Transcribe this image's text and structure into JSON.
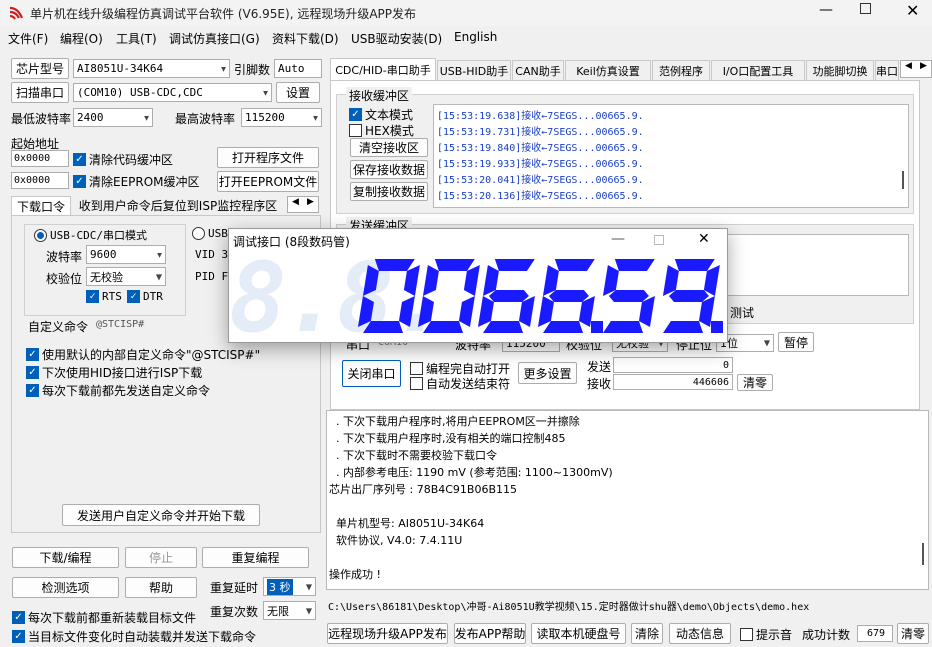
{
  "window": {
    "title": "单片机在线升级编程仿真调试平台软件 (V6.95E), 远程现场升级APP发布"
  },
  "menu": [
    "文件(F)",
    "编程(O)",
    "工具(T)",
    "调试仿真接口(G)",
    "资料下载(D)",
    "USB驱动安装(D)",
    "English"
  ],
  "left": {
    "chip_label": "芯片型号",
    "chip_value": "AI8051U-34K64",
    "rate_label": "引脚数",
    "rate_value": "Auto",
    "scan_label": "扫描串口",
    "port_value": "(COM10) USB-CDC,CDC",
    "settings_label": "设置",
    "min_baud_label": "最低波特率",
    "min_baud_value": "2400",
    "max_baud_label": "最高波特率",
    "max_baud_value": "115200",
    "start_addr_label": "起始地址",
    "addr1": "0x0000",
    "clear_code_label": "清除代码缓冲区",
    "open_prog_label": "打开程序文件",
    "addr2": "0x0000",
    "clear_eeprom_label": "清除EEPROM缓冲区",
    "open_eeprom_label": "打开EEPROM文件",
    "tab1": "下载口令",
    "tab2": "收到用户命令后复位到ISP监控程序区",
    "mode1": "USB-CDC/串口模式",
    "mode2": "USB",
    "baud_label": "波特率",
    "baud_value": "9600",
    "parity_label": "校验位",
    "parity_value": "无校验",
    "rts": "RTS",
    "dtr": "DTR",
    "vid": "VID  3",
    "pid": "PID  F",
    "custom_cmd_label": "自定义命令",
    "custom_cmd_value": "@STCISP#",
    "opt1": "使用默认的内部自定义命令\"@STCISP#\"",
    "opt2": "下次使用HID接口进行ISP下载",
    "opt3": "每次下载前都先发送自定义命令",
    "send_custom_label": "发送用户自定义命令并开始下载",
    "download_label": "下载/编程",
    "stop_label": "停止",
    "reprog_label": "重复编程",
    "detect_label": "检测选项",
    "help_label": "帮助",
    "delay_label": "重复延时",
    "delay_value": "3 秒",
    "count_label": "重复次数",
    "count_value": "无限",
    "opt4": "每次下载前都重新装载目标文件",
    "opt5": "当目标文件变化时自动装载并发送下载命令"
  },
  "tabs": [
    "CDC/HID-串口助手",
    "USB-HID助手",
    "CAN助手",
    "Keil仿真设置",
    "范例程序",
    "I/O口配置工具",
    "功能脚切换",
    "串口"
  ],
  "recv": {
    "group_label": "接收缓冲区",
    "text_mode": "文本模式",
    "hex_mode": "HEX模式",
    "clear_label": "清空接收区",
    "save_label": "保存接收数据",
    "copy_label": "复制接收数据",
    "lines": [
      "[15:53:19.638]接收←7SEGS...00665.9.",
      "[15:53:19.731]接收←7SEGS...00665.9.",
      "[15:53:19.840]接收←7SEGS...00665.9.",
      "[15:53:19.933]接收←7SEGS...00665.9.",
      "[15:53:20.041]接收←7SEGS...00665.9.",
      "[15:53:20.136]接收←7SEGS...00665.9."
    ]
  },
  "send": {
    "group_label": "发送缓冲区",
    "test_label": "测试",
    "port_label": "串口",
    "port_value": "COM10",
    "baud_label": "波特率",
    "baud_value": "115200",
    "parity_label": "校验位",
    "parity_value": "无校验",
    "stop_label": "停止位",
    "stop_value": "1位",
    "pause_label": "暂停",
    "close_label": "关闭串口",
    "auto_open": "编程完自动打开",
    "auto_send": "自动发送结束符",
    "more_label": "更多设置",
    "send_count_label": "发送",
    "send_count": "0",
    "recv_count_label": "接收",
    "recv_count": "446606",
    "clear_count_label": "清零"
  },
  "output": {
    "lines": [
      "  . 下次下载用户程序时,将用户EEPROM区一并擦除",
      "  . 下次下载用户程序时,没有相关的端口控制485",
      "  . 下次下载时不需要校验下载口令",
      "  . 内部参考电压: 1190 mV (参考范围: 1100~1300mV)",
      "芯片出厂序列号 : 78B4C91B06B115",
      "",
      "  单片机型号: AI8051U-34K64",
      "  软件协议, V4.0: 7.4.11U",
      "",
      "操作成功 !"
    ]
  },
  "path": "C:\\Users\\86181\\Desktop\\冲哥-Ai8051U教学视频\\15.定时器做计shu器\\demo\\Objects\\demo.hex",
  "bottom": {
    "remote_label": "远程现场升级APP发布",
    "help_label": "发布APP帮助",
    "read_disk_label": "读取本机硬盘号",
    "clear_label": "清除",
    "dynamic_label": "动态信息",
    "beep_label": "提示音",
    "success_label": "成功计数",
    "success_count": "679",
    "clear2_label": "清零"
  },
  "seg": {
    "title": "调试接口 (8段数码管)",
    "ghost": "8.8.",
    "digits": [
      "0",
      "0",
      "6",
      "6",
      "5",
      "9"
    ],
    "dp_after": [
      false,
      false,
      false,
      true,
      false,
      true
    ],
    "on_color": "#1a1aff",
    "off_color": "#e4ecf8"
  }
}
